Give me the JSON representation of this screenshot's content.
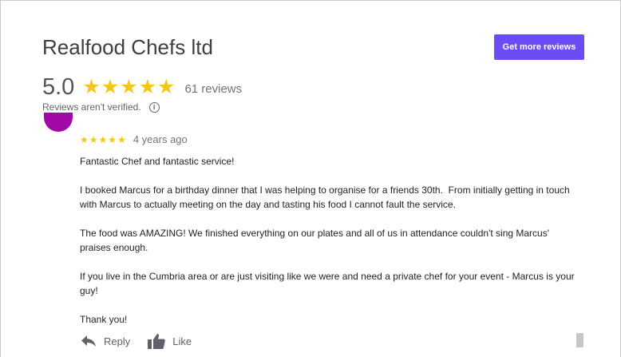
{
  "business": {
    "name": "Realfood Chefs ltd",
    "cta_label": "Get more reviews"
  },
  "summary": {
    "score": "5.0",
    "stars": 5,
    "review_count": "61 reviews",
    "verify_note": "Reviews aren't verified.",
    "info_glyph": "i"
  },
  "review": {
    "stars": 5,
    "date": "4 years ago",
    "paragraphs": [
      "Fantastic Chef and fantastic service!",
      "I booked Marcus for a birthday dinner that I was helping to organise for a friends 30th.  From initially getting in touch with Marcus to actually meeting on the day and tasting his food I cannot fault the service.",
      "The food was AMAZING! We finished everything on our plates and all of us in attendance couldn't sing Marcus' praises enough.",
      "If you live in the Cumbria area or are just visiting like we were and need a private chef for your event - Marcus is your guy!",
      "Thank you!"
    ],
    "actions": {
      "reply_label": "Reply",
      "like_label": "Like"
    }
  },
  "icons": {
    "star": "star-icon",
    "info": "info-icon",
    "reply": "reply-icon",
    "like": "thumbs-up-icon"
  },
  "colors": {
    "accent": "#6b4cf6",
    "star": "#f5c518",
    "avatar": "#a10aa8"
  }
}
